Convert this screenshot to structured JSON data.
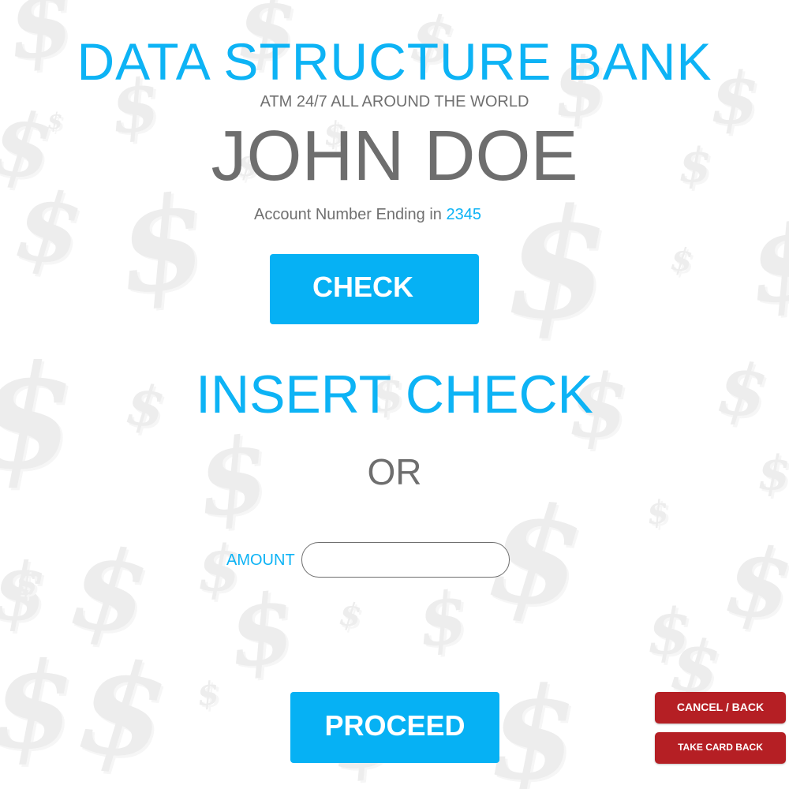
{
  "bank": {
    "title": "DATA STRUCTURE BANK",
    "tagline": "ATM 24/7 ALL AROUND THE WORLD"
  },
  "customer": {
    "name": "JOHN DOE",
    "account_prefix": "Account Number Ending in",
    "account_suffix": "2345"
  },
  "actions": {
    "check_label": "CHECK",
    "insert_heading": "INSERT CHECK",
    "or_text": "OR",
    "amount_label": "AMOUNT",
    "amount_value": "",
    "amount_placeholder": "",
    "proceed_label": "PROCEED",
    "cancel_label": "CANCEL / BACK",
    "take_card_label": "TAKE CARD BACK"
  },
  "background": {
    "pattern_icon": "dollar-sign-icon"
  },
  "colors": {
    "accent": "#0db3f5",
    "button": "#06b1f4",
    "danger": "#b51f24",
    "text_gray": "#6e6e6e"
  }
}
